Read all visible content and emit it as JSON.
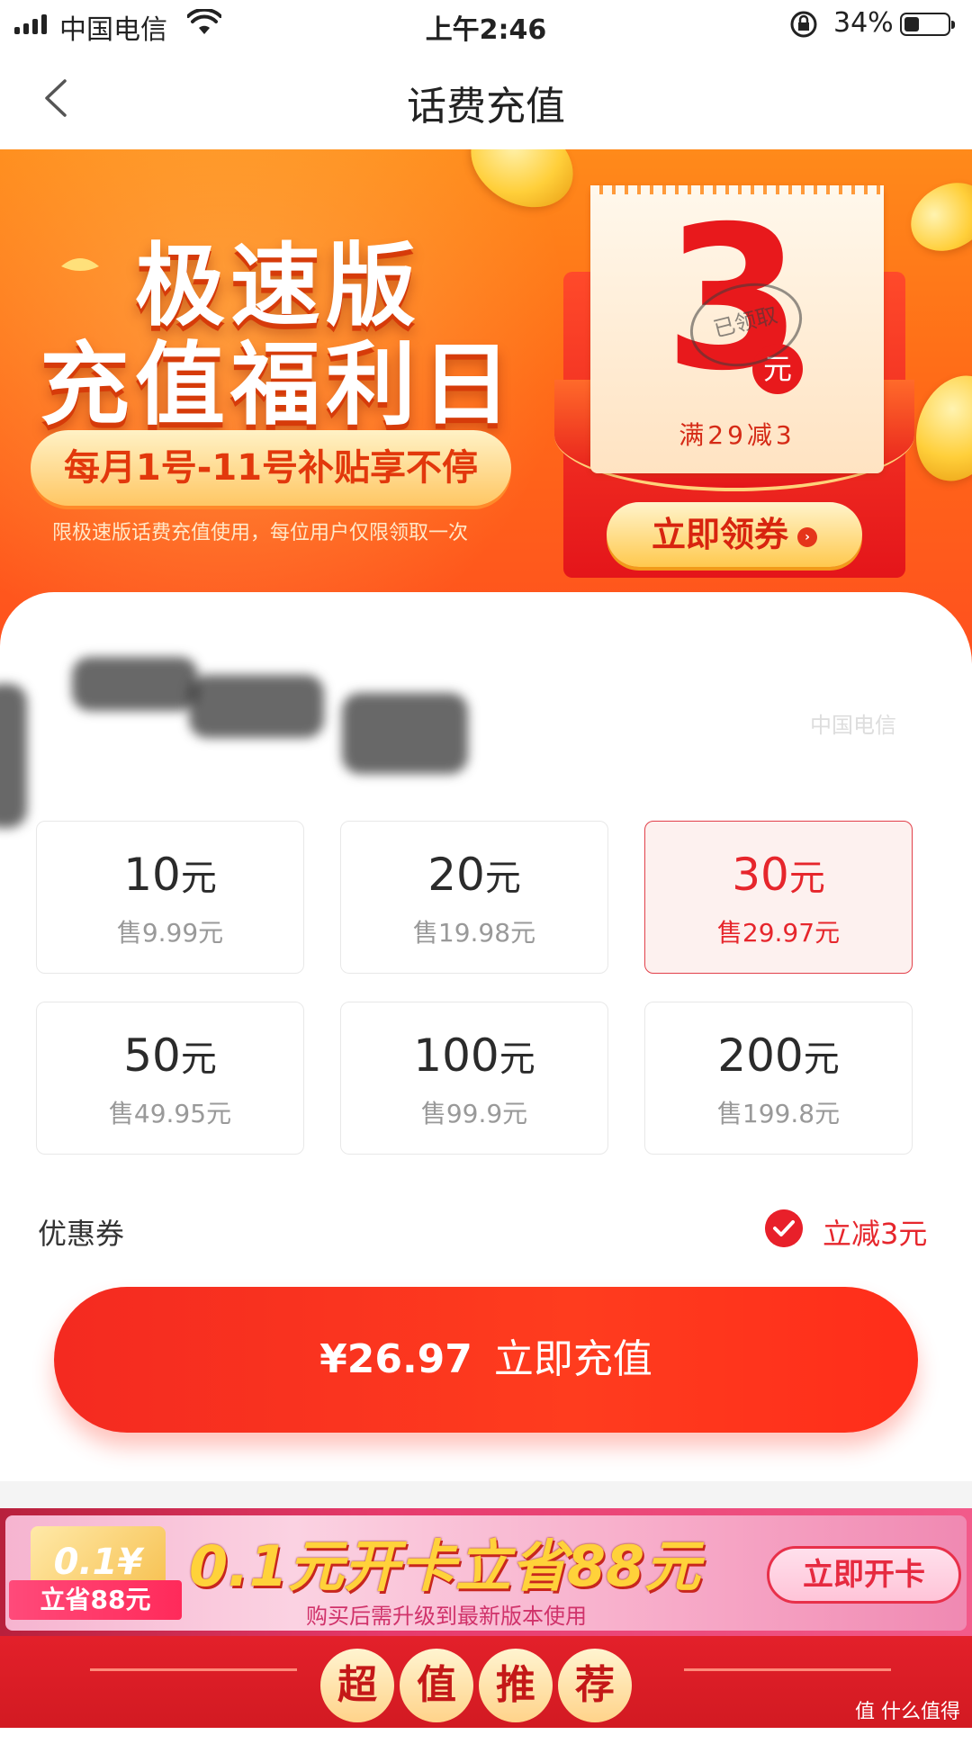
{
  "status_bar": {
    "carrier": "中国电信",
    "time": "上午2:46",
    "battery": "34%"
  },
  "nav": {
    "title": "话费充值",
    "back_icon": "chevron-left-icon"
  },
  "banner": {
    "title_line1": "极速版",
    "title_line2": "充值福利日",
    "subtitle": "每月1号-11号补贴享不停",
    "note": "限极速版话费充值使用，每位用户仅限领取一次",
    "coupon_amount": "3",
    "coupon_unit": "元",
    "coupon_stamp": "已领取",
    "coupon_condition": "满29减3",
    "claim_button": "立即领券"
  },
  "carrier_faint": "中国电信",
  "options": [
    {
      "face": "10",
      "unit": "元",
      "price": "售9.99元",
      "selected": false
    },
    {
      "face": "20",
      "unit": "元",
      "price": "售19.98元",
      "selected": false
    },
    {
      "face": "30",
      "unit": "元",
      "price": "售29.97元",
      "selected": true
    },
    {
      "face": "50",
      "unit": "元",
      "price": "售49.95元",
      "selected": false
    },
    {
      "face": "100",
      "unit": "元",
      "price": "售99.9元",
      "selected": false
    },
    {
      "face": "200",
      "unit": "元",
      "price": "售199.8元",
      "selected": false
    }
  ],
  "coupon_row": {
    "label": "优惠券",
    "value": "立减3元",
    "checked": true
  },
  "pay_button": {
    "amount": "¥26.97",
    "label": "立即充值"
  },
  "promo": {
    "card_text": "0.1¥",
    "save_tag": "立省88元",
    "title": "0.1元开卡立省88元",
    "subtitle": "购买后需升级到最新版本使用",
    "button": "立即开卡"
  },
  "recommend": {
    "chars": [
      "超",
      "值",
      "推",
      "荐"
    ]
  },
  "watermark": "值 什么值得买",
  "colors": {
    "accent_red": "#e6262c",
    "banner_orange": "#ff6a18"
  }
}
